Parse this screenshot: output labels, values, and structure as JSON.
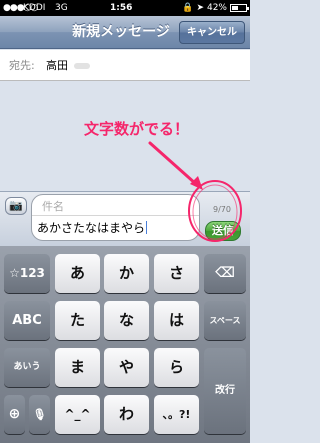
{
  "status_bar": {
    "signal": "●●●○○",
    "carrier": "KDDI",
    "network": "3G",
    "time": "1:56",
    "battery": "42%"
  },
  "nav": {
    "title": "新規メッセージ",
    "cancel_label": "キャンセル"
  },
  "recipient": {
    "label": "宛先:",
    "name": "高田"
  },
  "annotation": {
    "text": "文字数がでる！",
    "color": "#f5266b"
  },
  "compose": {
    "subject_placeholder": "件名",
    "body_text": "あかさたなはまやら",
    "char_count": "9/70",
    "send_label": "送信"
  },
  "keyboard": {
    "row1": {
      "mode_key": "☆123",
      "keys": [
        "あ",
        "か",
        "さ"
      ],
      "delete_key": "⌫"
    },
    "row2": {
      "mode_key": "ABC",
      "keys": [
        "た",
        "な",
        "は"
      ],
      "space_key": "スペース"
    },
    "row3": {
      "mode_key": "あいう",
      "keys": [
        "ま",
        "や",
        "ら"
      ],
      "enter_key": "改行"
    },
    "row4": {
      "globe_key": "⊕",
      "mic_key": "🎙",
      "keys": [
        "^_^",
        "わ",
        "、。?!"
      ]
    }
  },
  "colors": {
    "nav": "#7c93b3",
    "send": "#47a23a",
    "accent": "#f5266b"
  }
}
